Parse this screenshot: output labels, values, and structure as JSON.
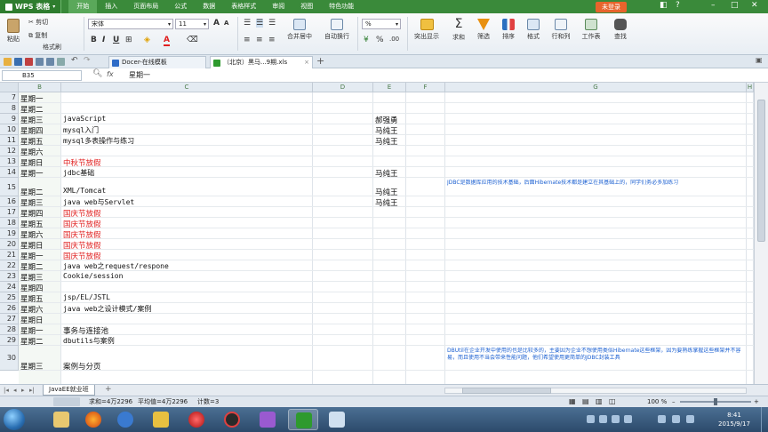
{
  "app": {
    "name": "WPS 表格",
    "login_label": "未登录"
  },
  "menu": [
    "开始",
    "插入",
    "页面布局",
    "公式",
    "数据",
    "表格样式",
    "审阅",
    "视图",
    "特色功能"
  ],
  "ribbon": {
    "paste": "粘贴",
    "cut": "剪切",
    "copy": "复制",
    "format_painter": "格式刷",
    "font_name": "宋体",
    "font_size": "11",
    "merge_center": "合并居中",
    "wrap_text": "自动换行",
    "number_format": "%",
    "table_style": "表格样式",
    "conditional_format": "突出显示",
    "sum": "求和",
    "filter": "筛选",
    "sort": "排序",
    "format": "格式",
    "row_col": "行和列",
    "worksheet": "工作表",
    "find": "查找"
  },
  "doc_tabs": [
    "Docer-在线模板",
    "（北京）黑马...9期.xls"
  ],
  "formula_bar": {
    "cell_ref": "B35",
    "fx": "fx",
    "content": "星期一"
  },
  "columns": [
    "B",
    "C",
    "D",
    "E",
    "F",
    "G",
    "H"
  ],
  "rows": [
    {
      "num": "7",
      "day": "星期一",
      "topic": "",
      "teacher": "",
      "note": ""
    },
    {
      "num": "8",
      "day": "星期二",
      "topic": "",
      "teacher": "",
      "note": ""
    },
    {
      "num": "9",
      "day": "星期三",
      "topic": "javaScript",
      "teacher": "郝强勇",
      "note": ""
    },
    {
      "num": "10",
      "day": "星期四",
      "topic": "mysql入门",
      "teacher": "马纯王",
      "note": ""
    },
    {
      "num": "11",
      "day": "星期五",
      "topic": "mysql多表操作与练习",
      "teacher": "马纯王",
      "note": ""
    },
    {
      "num": "12",
      "day": "星期六",
      "topic": "",
      "teacher": "",
      "note": ""
    },
    {
      "num": "13",
      "day": "星期日",
      "topic": "中秋节放假",
      "teacher": "",
      "note": "",
      "red": true
    },
    {
      "num": "14",
      "day": "星期一",
      "topic": "jdbc基础",
      "teacher": "马纯王",
      "note": ""
    },
    {
      "num": "15",
      "day": "星期二",
      "topic": "XML/Tomcat",
      "teacher": "马纯王",
      "note": "JDBC是数据库应用的技术基础，后面Hibernate技术都是建立在其基础上的，同学们务必多加练习"
    },
    {
      "num": "16",
      "day": "星期三",
      "topic": "java web与Servlet",
      "teacher": "马纯王",
      "note": ""
    },
    {
      "num": "17",
      "day": "星期四",
      "topic": "国庆节放假",
      "teacher": "",
      "note": "",
      "red": true
    },
    {
      "num": "18",
      "day": "星期五",
      "topic": "国庆节放假",
      "teacher": "",
      "note": "",
      "red": true
    },
    {
      "num": "19",
      "day": "星期六",
      "topic": "国庆节放假",
      "teacher": "",
      "note": "",
      "red": true
    },
    {
      "num": "20",
      "day": "星期日",
      "topic": "国庆节放假",
      "teacher": "",
      "note": "",
      "red": true
    },
    {
      "num": "21",
      "day": "星期一",
      "topic": "国庆节放假",
      "teacher": "",
      "note": "",
      "red": true
    },
    {
      "num": "22",
      "day": "星期二",
      "topic": "java web之request/respone",
      "teacher": "",
      "note": ""
    },
    {
      "num": "23",
      "day": "星期三",
      "topic": "Cookie/session",
      "teacher": "",
      "note": ""
    },
    {
      "num": "24",
      "day": "星期四",
      "topic": "",
      "teacher": "",
      "note": ""
    },
    {
      "num": "25",
      "day": "星期五",
      "topic": "jsp/EL/JSTL",
      "teacher": "",
      "note": ""
    },
    {
      "num": "26",
      "day": "星期六",
      "topic": "java web之设计模式/案例",
      "teacher": "",
      "note": ""
    },
    {
      "num": "27",
      "day": "星期日",
      "topic": "",
      "teacher": "",
      "note": ""
    },
    {
      "num": "28",
      "day": "星期一",
      "topic": "事务与连接池",
      "teacher": "",
      "note": ""
    },
    {
      "num": "29",
      "day": "星期二",
      "topic": "dbutils与案例",
      "teacher": "",
      "note": ""
    },
    {
      "num": "30",
      "day": "星期三",
      "topic": "案例与分页",
      "teacher": "",
      "note": "DBUtil在企业开发中使用的也是比较多的，主要因为企业不想使用类似Hibernate这些框架，因为要熟练掌握这些框架并不容易，而且使用不当会带来性能问题，他们希望使用更简单的JDBC封装工具"
    }
  ],
  "sheet_tab": "JavaEE就业班",
  "status": {
    "sum": "求和=4万2296",
    "avg": "平均值=4万2296",
    "count": "计数=3",
    "zoom": "100 %"
  },
  "clock": {
    "time": "8:41",
    "date": "2015/9/17"
  }
}
